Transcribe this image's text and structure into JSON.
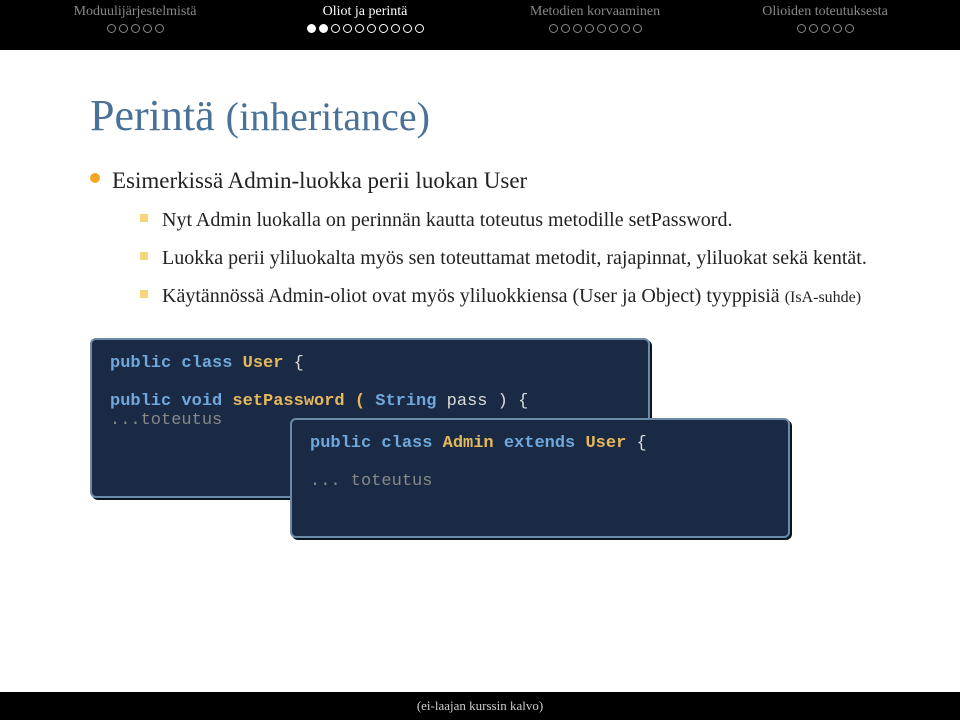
{
  "nav": {
    "sections": [
      {
        "label": "Moduulijärjestelmistä",
        "active": false,
        "dots": [
          "empty",
          "empty",
          "empty",
          "empty",
          "empty"
        ]
      },
      {
        "label": "Oliot ja perintä",
        "active": true,
        "dots": [
          "active_done",
          "active_done",
          "active_outline",
          "active_outline",
          "active_outline",
          "active_outline",
          "active_outline",
          "active_outline",
          "active_outline",
          "active_outline"
        ]
      },
      {
        "label": "Metodien korvaaminen",
        "active": false,
        "dots": [
          "empty",
          "empty",
          "empty",
          "empty",
          "empty",
          "empty",
          "empty",
          "empty"
        ]
      },
      {
        "label": "Olioiden toteutuksesta",
        "active": false,
        "dots": [
          "empty",
          "empty",
          "empty",
          "empty",
          "empty"
        ]
      }
    ]
  },
  "title_main": "Perintä",
  "title_paren": "(inheritance)",
  "bullet_main": "Esimerkissä Admin-luokka perii luokan User",
  "sub": [
    "Nyt Admin luokalla on perinnän kautta toteutus metodille setPassword.",
    "Luokka perii yliluokalta myös sen toteuttamat metodit, rajapinnat, yliluokat sekä kentät.",
    "Käytännössä Admin-oliot ovat myös yliluokkiensa (User ja Object) tyyppisiä"
  ],
  "sub3_note": "(IsA-suhde)",
  "code1": {
    "l1_kw1": "public class",
    "l1_cls": "User",
    "l1_brace": " {",
    "l2_indent": "    ",
    "l2_kw1": "public void",
    "l2_name": " setPassword ( ",
    "l2_kw2": "String",
    "l2_rest": " pass ) {",
    "l3": "    ...toteutus"
  },
  "code2": {
    "l1_kw1": "public class",
    "l1_cls": "Admin",
    "l1_kw2": " extends ",
    "l1_cls2": "User",
    "l1_brace": " {",
    "l2": "    ... toteutus"
  },
  "footer": "(ei-laajan kurssin kalvo)"
}
